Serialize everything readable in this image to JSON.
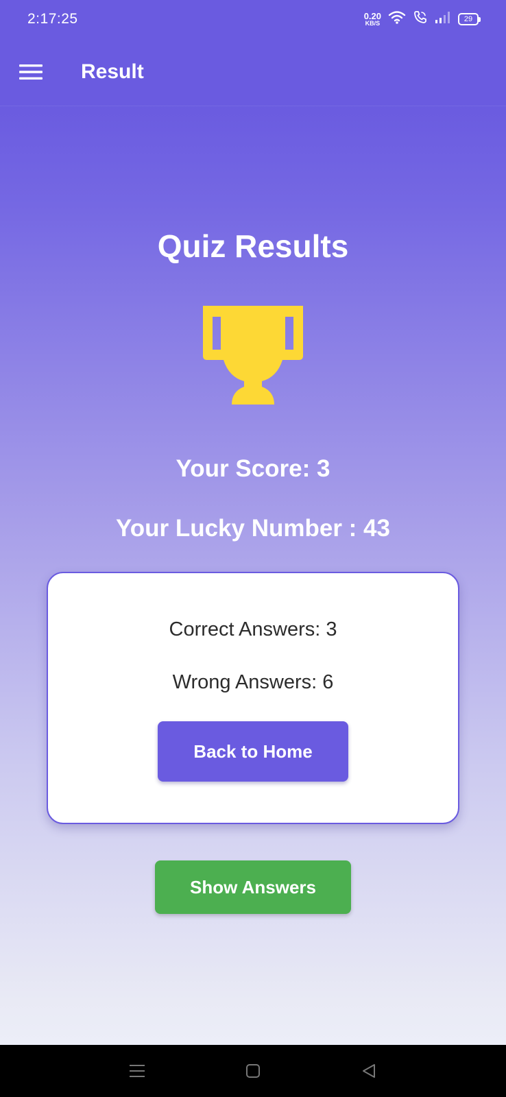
{
  "status_bar": {
    "time": "2:17:25",
    "net_speed_value": "0.20",
    "net_speed_unit": "KB/S",
    "battery_level": "29",
    "icons": [
      "wifi-icon",
      "wifi-call-icon",
      "signal-icon",
      "battery-icon"
    ]
  },
  "app_bar": {
    "title": "Result",
    "menu_icon": "hamburger-menu-icon"
  },
  "main": {
    "heading": "Quiz Results",
    "trophy_icon": "trophy-icon",
    "score_text": "Your Score: 3",
    "lucky_text": "Your Lucky Number : 43"
  },
  "card": {
    "correct_text": "Correct Answers: 3",
    "wrong_text": "Wrong Answers: 6",
    "home_button_label": "Back to Home"
  },
  "actions": {
    "show_answers_label": "Show Answers"
  },
  "nav_bar": {
    "icons": [
      "recents-icon",
      "home-icon",
      "back-icon"
    ]
  },
  "colors": {
    "primary": "#6a5be0",
    "success": "#4caf50",
    "trophy": "#fdd835",
    "card_background": "#ffffff"
  }
}
